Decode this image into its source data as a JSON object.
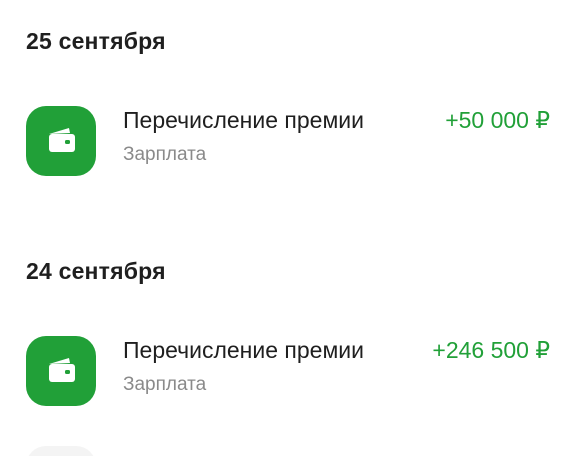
{
  "groups": [
    {
      "date": "25 сентября",
      "transactions": [
        {
          "title": "Перечисление премии",
          "category": "Зарплата",
          "amount": "+50 000 ₽",
          "icon": "wallet-icon"
        }
      ]
    },
    {
      "date": "24 сентября",
      "transactions": [
        {
          "title": "Перечисление премии",
          "category": "Зарплата",
          "amount": "+246 500 ₽",
          "icon": "wallet-icon"
        }
      ]
    }
  ],
  "colors": {
    "accent": "#21a038",
    "text_primary": "#1f1f1f",
    "text_secondary": "#8a8a8a",
    "background": "#ffffff"
  }
}
